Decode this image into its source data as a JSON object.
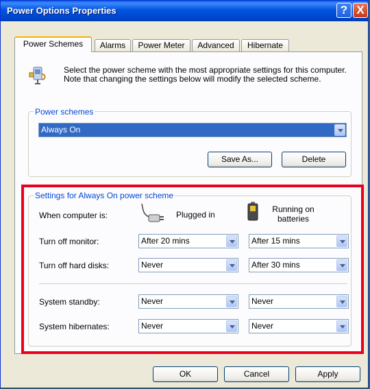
{
  "window": {
    "title": "Power Options Properties"
  },
  "titlebar_buttons": {
    "help": "?",
    "close": "X"
  },
  "tabs": [
    {
      "label": "Power Schemes",
      "active": true
    },
    {
      "label": "Alarms"
    },
    {
      "label": "Power Meter"
    },
    {
      "label": "Advanced"
    },
    {
      "label": "Hibernate"
    }
  ],
  "intro": {
    "text": "Select the power scheme with the most appropriate settings for this computer. Note that changing the settings below will modify the selected scheme."
  },
  "schemes": {
    "legend": "Power schemes",
    "selected": "Always On",
    "save_as_label": "Save As...",
    "delete_label": "Delete"
  },
  "settings": {
    "legend": "Settings for Always On power scheme",
    "when_label": "When computer is:",
    "plugged_in_label": "Plugged in",
    "batteries_label": "Running on batteries",
    "rows": [
      {
        "label": "Turn off monitor:",
        "plugged": "After 20 mins",
        "battery": "After 15 mins"
      },
      {
        "label": "Turn off hard disks:",
        "plugged": "Never",
        "battery": "After 30 mins"
      },
      {
        "label": "System standby:",
        "plugged": "Never",
        "battery": "Never"
      },
      {
        "label": "System hibernates:",
        "plugged": "Never",
        "battery": "Never"
      }
    ]
  },
  "footer": {
    "ok_label": "OK",
    "cancel_label": "Cancel",
    "apply_label": "Apply"
  },
  "colors": {
    "highlight": "#e8001c",
    "titlebar": "#0053e1",
    "selection": "#316ac5"
  }
}
